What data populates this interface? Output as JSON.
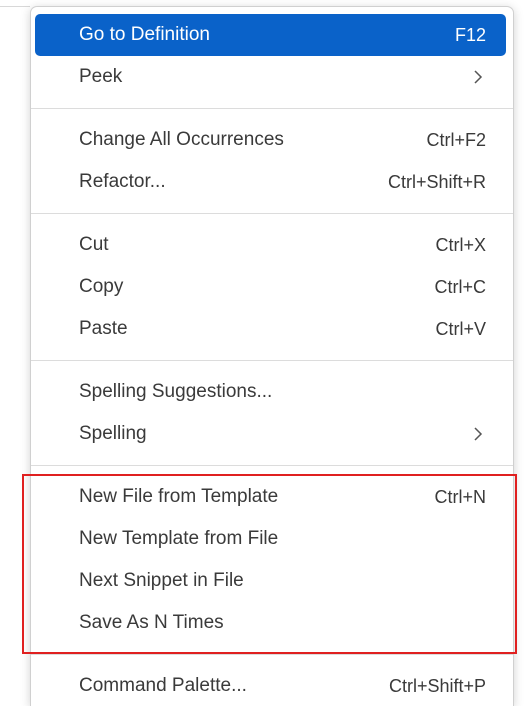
{
  "menu": {
    "groups": [
      {
        "items": [
          {
            "label": "Go to Definition",
            "shortcut": "F12",
            "active": true
          },
          {
            "label": "Peek",
            "submenu": true
          }
        ]
      },
      {
        "items": [
          {
            "label": "Change All Occurrences",
            "shortcut": "Ctrl+F2"
          },
          {
            "label": "Refactor...",
            "shortcut": "Ctrl+Shift+R"
          }
        ]
      },
      {
        "items": [
          {
            "label": "Cut",
            "shortcut": "Ctrl+X"
          },
          {
            "label": "Copy",
            "shortcut": "Ctrl+C"
          },
          {
            "label": "Paste",
            "shortcut": "Ctrl+V"
          }
        ]
      },
      {
        "items": [
          {
            "label": "Spelling Suggestions..."
          },
          {
            "label": "Spelling",
            "submenu": true
          }
        ]
      },
      {
        "items": [
          {
            "label": "New File from Template",
            "shortcut": "Ctrl+N"
          },
          {
            "label": "New Template from File"
          },
          {
            "label": "Next Snippet in File"
          },
          {
            "label": "Save As N Times"
          }
        ]
      },
      {
        "items": [
          {
            "label": "Command Palette...",
            "shortcut": "Ctrl+Shift+P"
          }
        ]
      }
    ]
  },
  "colors": {
    "active_bg": "#0a62c9",
    "text": "#3a3a3a",
    "highlight_border": "#e02020"
  },
  "icons": {
    "submenu": "chevron-right-icon"
  }
}
